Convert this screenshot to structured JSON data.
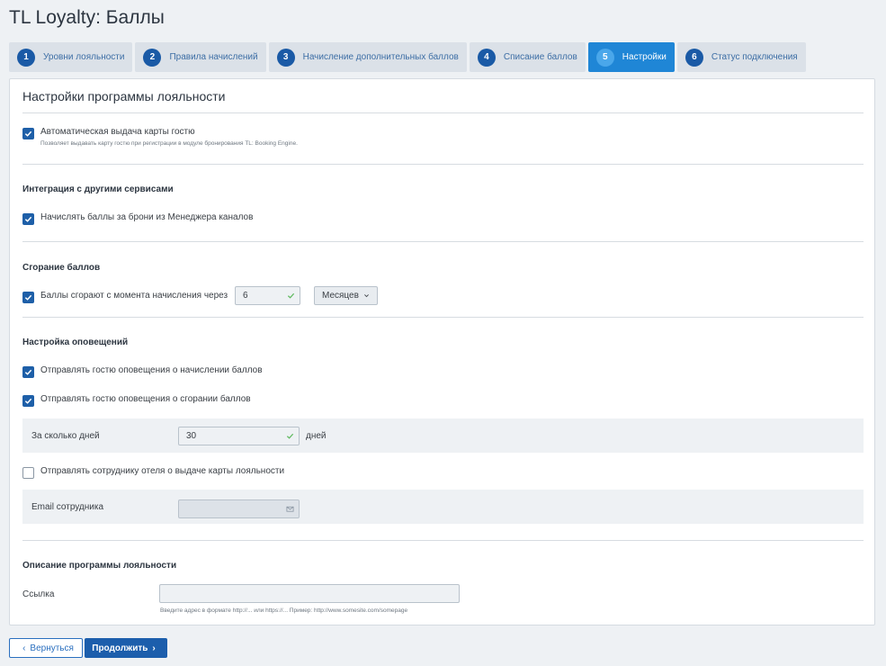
{
  "page": {
    "title": "TL Loyalty: Баллы"
  },
  "steps": [
    {
      "num": "1",
      "label": "Уровни лояльности"
    },
    {
      "num": "2",
      "label": "Правила начислений"
    },
    {
      "num": "3",
      "label": "Начисление дополнительных баллов"
    },
    {
      "num": "4",
      "label": "Списание баллов"
    },
    {
      "num": "5",
      "label": "Настройки",
      "active": true
    },
    {
      "num": "6",
      "label": "Статус подключения"
    }
  ],
  "panel": {
    "title": "Настройки программы лояльности",
    "auto_card": {
      "label": "Автоматическая выдача карты гостю",
      "sub": "Позволяет выдавать карту гостю при регистрации в модуле бронирования TL: Booking Engine.",
      "checked": true
    },
    "integration": {
      "title": "Интеграция с другими сервисами",
      "channel_manager": {
        "label": "Начислять баллы за брони из Менеджера каналов",
        "checked": true
      }
    },
    "expiry": {
      "title": "Сгорание баллов",
      "label": "Баллы сгорают с момента начисления через",
      "checked": true,
      "value": "6",
      "unit_select": "Месяцев"
    },
    "notifications": {
      "title": "Настройка оповещений",
      "accrual": {
        "label": "Отправлять гостю оповещения о начислении баллов",
        "checked": true
      },
      "expiry": {
        "label": "Отправлять гостю оповещения о сгорании баллов",
        "checked": true
      },
      "days_label": "За сколько дней",
      "days_value": "30",
      "days_unit": "дней",
      "staff": {
        "label": "Отправлять сотруднику отеля о выдаче карты лояльности",
        "checked": false
      },
      "email_label": "Email сотрудника",
      "email_value": ""
    },
    "description": {
      "title": "Описание программы лояльности",
      "link_label": "Ссылка",
      "link_value": "",
      "link_hint": "Введите адрес в формате http://... или https://... Пример: http://www.somesite.com/somepage"
    }
  },
  "footer": {
    "back_label": "Вернуться",
    "next_label": "Продолжить"
  },
  "colors": {
    "primary": "#1c5eac",
    "active_tab": "#1f86d6",
    "page_bg": "#eef1f4"
  }
}
